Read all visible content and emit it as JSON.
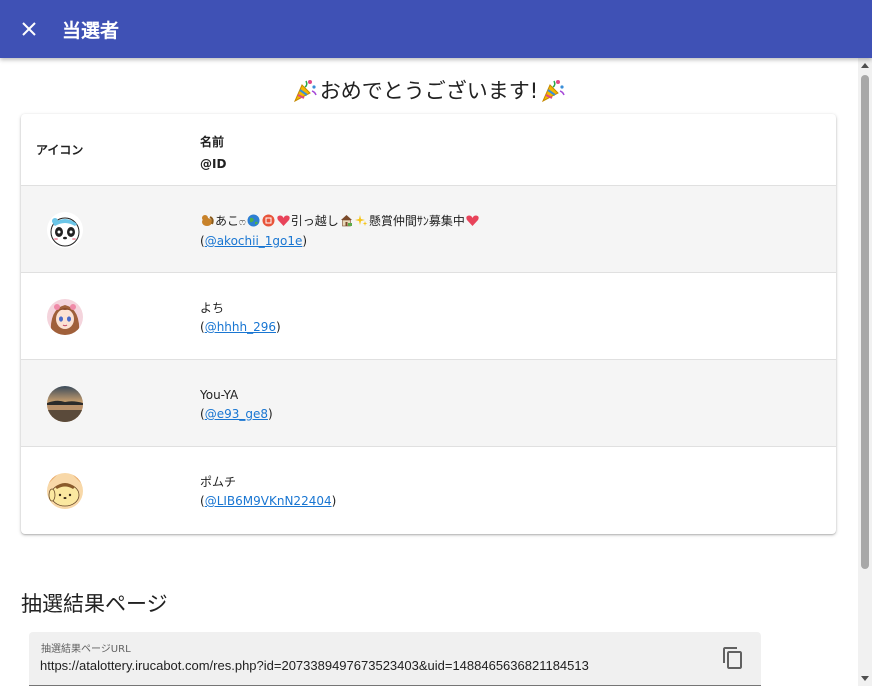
{
  "toolbar": {
    "title": "当選者",
    "close_icon": "close-icon",
    "background": "#3f51b5"
  },
  "congrats": {
    "text": "おめでとうございます!",
    "icon": "party-popper-icon"
  },
  "table": {
    "headers": {
      "icon": "アイコン",
      "name": "名前",
      "id": "@ID"
    },
    "rows": [
      {
        "name_parts": [
          "あこ",
          "ෆ",
          "引っ越し",
          "懸賞仲間ｻﾝ募集中"
        ],
        "name": "🐿あこෆ🌏🈵❤引っ越し🏠✨懸賞仲間ｻﾝ募集中❤",
        "id": "@akochii_1go1e",
        "avatar": "panda-avatar"
      },
      {
        "name": "よち",
        "id": "@hhhh_296",
        "avatar": "anime-girl-avatar"
      },
      {
        "name": "You-YA",
        "id": "@e93_ge8",
        "avatar": "sunset-lake-avatar"
      },
      {
        "name": "ポムチ",
        "id": "@LIB6M9VKnN22404",
        "avatar": "pompompurin-avatar"
      }
    ],
    "paren_open": "(",
    "paren_close": ")"
  },
  "result_page": {
    "title": "抽選結果ページ",
    "field_label": "抽選結果ページURL",
    "url": "https://atalottery.irucabot.com/res.php?id=2073389497673523403&uid=1488465636821184513",
    "copy_icon": "copy-icon"
  },
  "colors": {
    "primary": "#3f51b5",
    "link": "#1976d2"
  }
}
